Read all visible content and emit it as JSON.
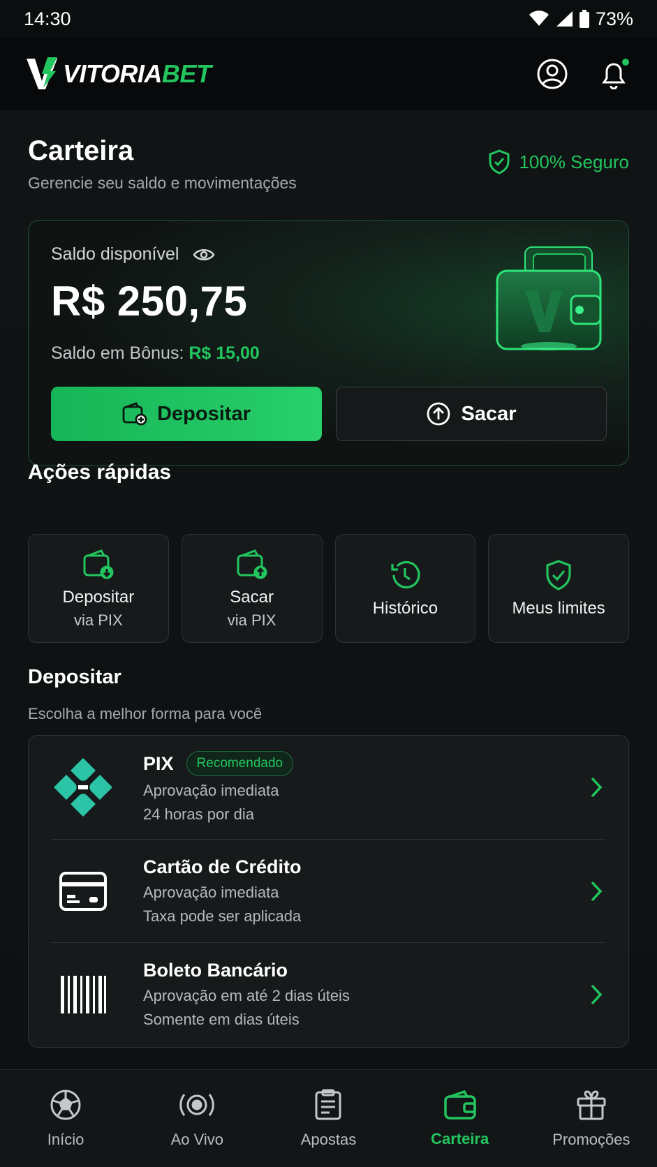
{
  "status": {
    "time": "14:30",
    "battery": "73%"
  },
  "brand": {
    "name_white": "VITORIA",
    "name_green": "BET"
  },
  "header": {
    "title": "Carteira",
    "subtitle": "Gerencie seu saldo e movimentações",
    "secure_label": "100% Seguro"
  },
  "balance": {
    "label": "Saldo disponível",
    "value": "R$ 250,75",
    "bonus_label": "Saldo em Bônus:",
    "bonus_value": "R$ 15,00",
    "deposit_label": "Depositar",
    "withdraw_label": "Sacar"
  },
  "quick_actions": {
    "title": "Ações rápidas",
    "items": [
      {
        "line1": "Depositar",
        "line2": "via PIX",
        "icon": "wallet-deposit-icon"
      },
      {
        "line1": "Sacar",
        "line2": "via PIX",
        "icon": "wallet-withdraw-icon"
      },
      {
        "line1": "Histórico",
        "line2": "",
        "icon": "history-icon"
      },
      {
        "line1": "Meus limites",
        "line2": "",
        "icon": "shield-check-icon"
      }
    ]
  },
  "deposit": {
    "title": "Depositar",
    "subtitle": "Escolha a melhor forma para você",
    "methods": [
      {
        "title": "PIX",
        "badge": "Recomendado",
        "line1": "Aprovação imediata",
        "line2": "24 horas por dia",
        "icon": "pix-icon"
      },
      {
        "title": "Cartão de Crédito",
        "line1": "Aprovação imediata",
        "line2": "Taxa pode ser aplicada",
        "icon": "credit-card-icon"
      },
      {
        "title": "Boleto Bancário",
        "line1": "Aprovação em até 2 dias úteis",
        "line2": "Somente em dias úteis",
        "icon": "barcode-icon"
      }
    ]
  },
  "nav": {
    "items": [
      {
        "label": "Início",
        "icon": "soccer-ball-icon"
      },
      {
        "label": "Ao Vivo",
        "icon": "live-icon"
      },
      {
        "label": "Apostas",
        "icon": "betslip-icon"
      },
      {
        "label": "Carteira",
        "icon": "wallet-icon"
      },
      {
        "label": "Promoções",
        "icon": "gift-icon"
      }
    ],
    "active_index": 3
  },
  "colors": {
    "accent": "#22c55e",
    "background": "#0b0e0f",
    "card": "#161a1b"
  }
}
